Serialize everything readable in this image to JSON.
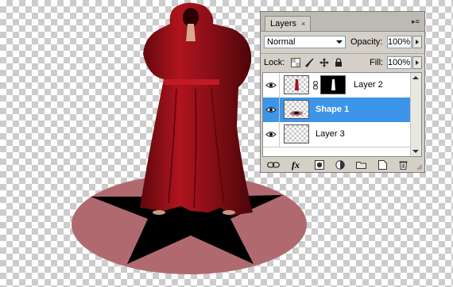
{
  "panel": {
    "tab_label": "Layers",
    "tab_close": "×",
    "menu_glyph": "▸≡",
    "blend_mode": "Normal",
    "opacity_label": "Opacity:",
    "opacity_value": "100%",
    "lock_label": "Lock:",
    "fill_label": "Fill:",
    "fill_value": "100%",
    "fx_label": "fx"
  },
  "layers": [
    {
      "name": "Layer 2",
      "selected": false,
      "has_mask": true
    },
    {
      "name": "Shape 1",
      "selected": true,
      "has_mask": false
    },
    {
      "name": "Layer 3",
      "selected": false,
      "has_mask": false
    }
  ],
  "icons": {
    "visibility": "eye-icon",
    "link": "chain-link-icon",
    "lock_transparent": "lock-transparent-pixels-icon",
    "lock_image": "brush-icon",
    "lock_position": "move-icon",
    "lock_all": "padlock-icon",
    "bottom": [
      "link-layers-icon",
      "fx-icon",
      "add-mask-icon",
      "adjustment-layer-icon",
      "new-group-icon",
      "new-layer-icon",
      "trash-icon"
    ]
  },
  "colors": {
    "selection": "#3d95ea",
    "circle": "#b06a6f",
    "robe": "#a3121c",
    "star": "#000000"
  }
}
